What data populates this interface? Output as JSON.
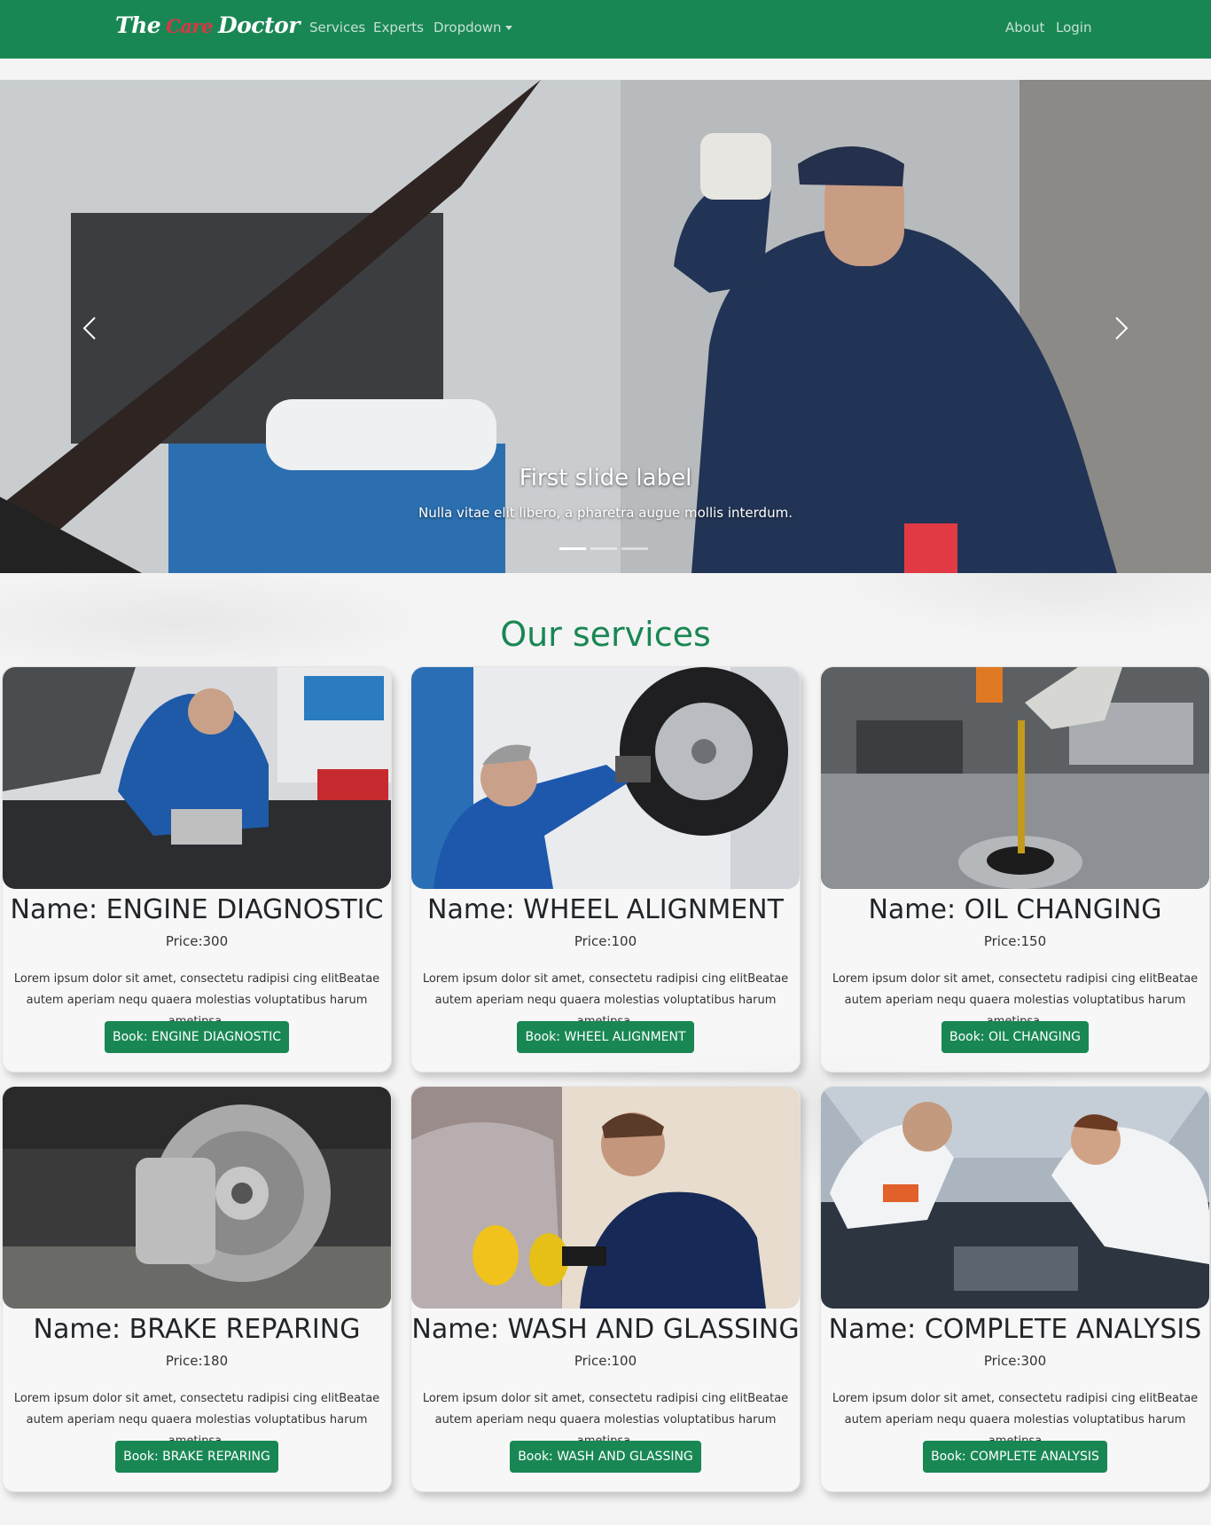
{
  "navbar": {
    "brand_left": "The",
    "brand_mid": "Care",
    "brand_right": "Doctor",
    "links": [
      "Services",
      "Experts",
      "Dropdown"
    ],
    "right_links": [
      "About",
      "Login"
    ],
    "color": "#198754"
  },
  "carousel": {
    "caption_title": "First slide label",
    "caption_text": "Nulla vitae elit libero, a pharetra augue mollis interdum.",
    "slide_count": 3,
    "active_slide": 1
  },
  "services": {
    "title": "Our services",
    "cards": [
      {
        "name": "Name: ENGINE DIAGNOSTIC",
        "price": "Price:300",
        "desc": "Lorem ipsum dolor sit amet, consectetu radipisi cing elitBeatae autem aperiam nequ quaera molestias voluptatibus harum ametipsa.",
        "button": "Book: ENGINE DIAGNOSTIC"
      },
      {
        "name": "Name: WHEEL ALIGNMENT",
        "price": "Price:100",
        "desc": "Lorem ipsum dolor sit amet, consectetu radipisi cing elitBeatae autem aperiam nequ quaera molestias voluptatibus harum ametipsa.",
        "button": "Book: WHEEL ALIGNMENT"
      },
      {
        "name": "Name: OIL CHANGING",
        "price": "Price:150",
        "desc": "Lorem ipsum dolor sit amet, consectetu radipisi cing elitBeatae autem aperiam nequ quaera molestias voluptatibus harum ametipsa.",
        "button": "Book: OIL CHANGING"
      },
      {
        "name": "Name: BRAKE REPARING",
        "price": "Price:180",
        "desc": "Lorem ipsum dolor sit amet, consectetu radipisi cing elitBeatae autem aperiam nequ quaera molestias voluptatibus harum ametipsa.",
        "button": "Book: BRAKE REPARING"
      },
      {
        "name": "Name: WASH AND GLASSING",
        "price": "Price:100",
        "desc": "Lorem ipsum dolor sit amet, consectetu radipisi cing elitBeatae autem aperiam nequ quaera molestias voluptatibus harum ametipsa.",
        "button": "Book: WASH AND GLASSING"
      },
      {
        "name": "Name: COMPLETE ANALYSIS",
        "price": "Price:300",
        "desc": "Lorem ipsum dolor sit amet, consectetu radipisi cing elitBeatae autem aperiam nequ quaera molestias voluptatibus harum ametipsa",
        "button": "Book: COMPLETE ANALYSIS"
      }
    ]
  }
}
